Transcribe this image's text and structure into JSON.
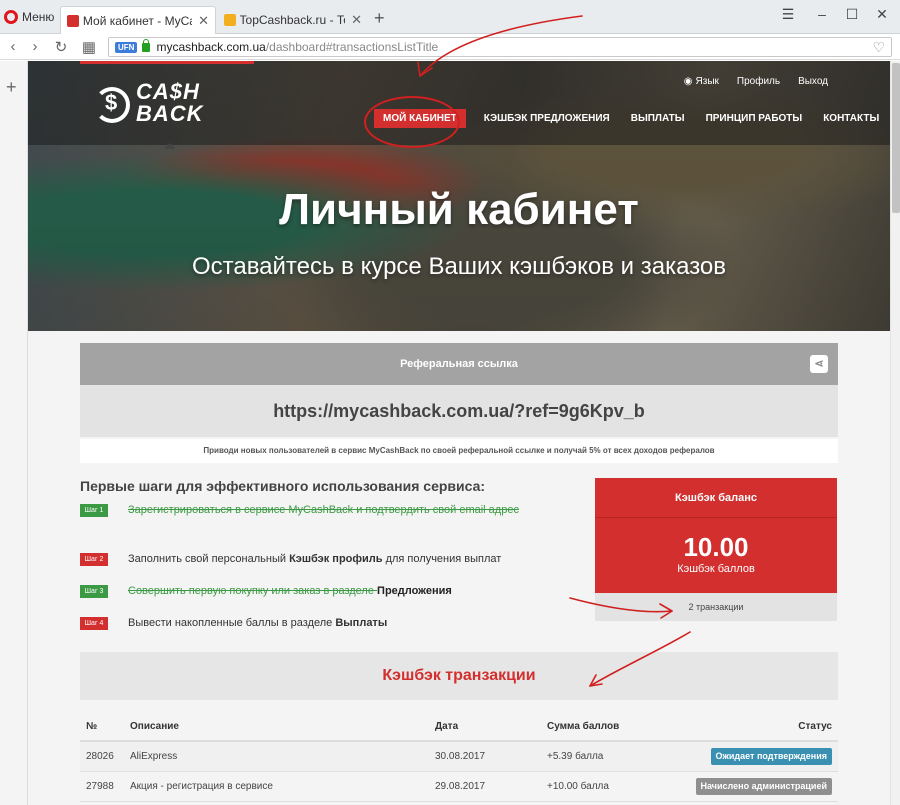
{
  "browser": {
    "menu_label": "Меню",
    "tabs": [
      {
        "label": "Мой кабинет - MyCashBa",
        "active": true
      },
      {
        "label": "TopCashback.ru - Топ луч",
        "active": false
      }
    ],
    "url_host": "mycashback.com.ua",
    "url_path": "/dashboard#transactionsListTitle",
    "url_badge": "UFN"
  },
  "site": {
    "logo_line1": "CA$H",
    "logo_line2": "BACK",
    "top_links": [
      "Язык",
      "Профиль",
      "Выход"
    ],
    "nav": [
      "МОЙ КАБИНЕТ",
      "КЭШБЭК ПРЕДЛОЖЕНИЯ",
      "ВЫПЛАТЫ",
      "ПРИНЦИП РАБОТЫ",
      "КОНТАКТЫ"
    ],
    "hero_title": "Личный кабинет",
    "hero_subtitle": "Оставайтесь в курсе Ваших кэшбэков и заказов"
  },
  "referral": {
    "title": "Реферальная ссылка",
    "link": "https://mycashback.com.ua/?ref=9g6Kpv_b",
    "note": "Приводи новых пользователей в сервис MyCashBack по своей реферальной ссылке и получай 5% от всех доходов рефералов"
  },
  "steps": {
    "title": "Первые шаги для эффективного использования сервиса:",
    "items": [
      {
        "badge": "Шаг 1",
        "text": "Зарегистрироваться в сервисе MyCashBack и подтвердить свой email адрес",
        "tail": "",
        "done": true
      },
      {
        "badge": "Шаг 2",
        "text": "Заполнить свой персональный ",
        "bold": "Кэшбэк профиль",
        "tail": " для получения выплат",
        "done": false
      },
      {
        "badge": "Шаг 3",
        "text": "Совершить первую покупку или заказ в разделе ",
        "bold": "Предложения",
        "tail": "",
        "done": true
      },
      {
        "badge": "Шаг 4",
        "text": "Вывести накопленные баллы в разделе ",
        "bold": "Выплаты",
        "tail": "",
        "done": false
      }
    ]
  },
  "balance": {
    "title": "Кэшбэк баланс",
    "value": "10.00",
    "unit": "Кэшбэк баллов",
    "transactions": "2 транзакции"
  },
  "transactions": {
    "title": "Кэшбэк транзакции",
    "columns": [
      "№",
      "Описание",
      "Дата",
      "Сумма баллов",
      "Статус"
    ],
    "rows": [
      {
        "num": "28026",
        "desc": "AliExpress",
        "date": "30.08.2017",
        "sum": "+5.39 балла",
        "status": "Ожидает подтверждения"
      },
      {
        "num": "27988",
        "desc": "Акция - регистрация в сервисе",
        "date": "29.08.2017",
        "sum": "+10.00 балла",
        "status": "Начислено администрацией"
      }
    ]
  },
  "colors": {
    "accent": "#d32f2f",
    "done_green": "#3c9a45",
    "status_pending": "#3a90b0",
    "status_admin": "#8f8f8f"
  }
}
